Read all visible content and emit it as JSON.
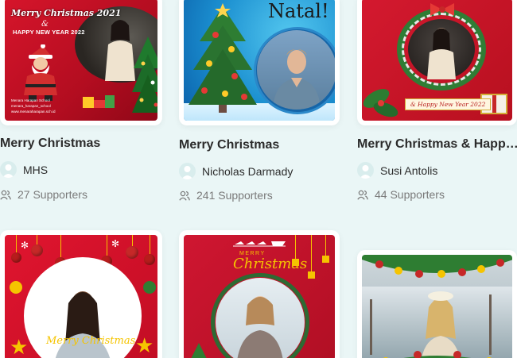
{
  "cards": [
    {
      "title": "Merry Christmas",
      "author": "MHS",
      "supporters": "27 Supporters",
      "art": {
        "line1": "Merry Christmas 2021",
        "line2": "&",
        "line3": "HAPPY NEW YEAR 2022",
        "footer1": "Menara Harapan School",
        "footer2": "menara_harapan_school",
        "footer3": "www.menaraharapan.sch.id"
      }
    },
    {
      "title": "Merry Christmas",
      "author": "Nicholas Darmady",
      "supporters": "241 Supporters",
      "art": {
        "heading": "Natal!"
      }
    },
    {
      "title": "Merry Christmas & Happ…",
      "author": "Susi Antolis",
      "supporters": "44 Supporters",
      "art": {
        "ribbon": "& Happy New Year 2022"
      }
    },
    {
      "title": "",
      "author": "",
      "supporters": "",
      "art": {
        "script": "Merry Christmas"
      }
    },
    {
      "title": "",
      "author": "",
      "supporters": "",
      "art": {
        "line1": "MERRY",
        "line2": "Christmas"
      }
    },
    {
      "title": "",
      "author": "",
      "supporters": "",
      "art": {}
    }
  ],
  "colors": {
    "background": "#eaf6f6",
    "title_text": "#2b2b2b",
    "muted_text": "#7a7a7a",
    "avatar_bg": "#d9eded",
    "frame_red": "#c8102e"
  },
  "icons": {
    "avatar": "user-avatar-icon",
    "supporters": "users-icon"
  }
}
